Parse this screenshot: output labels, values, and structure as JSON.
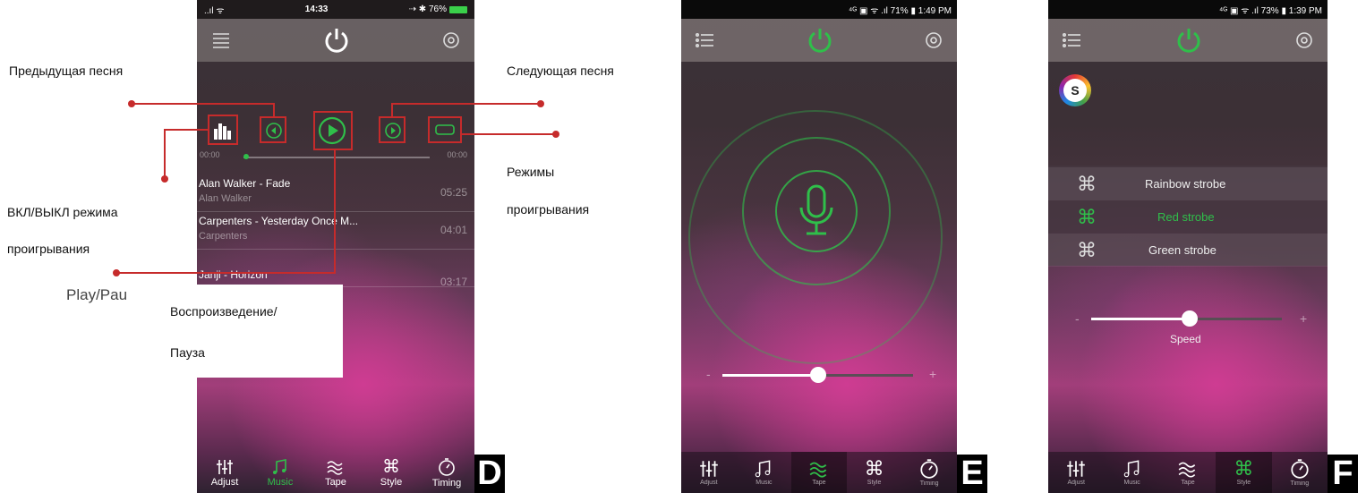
{
  "panels": {
    "d": {
      "status": {
        "signal": "..ıl ᯤ",
        "time": "14:33",
        "right": "⇢ ✱ 76%"
      },
      "song_times": {
        "start": "00:00",
        "end": "00:00"
      },
      "songs": [
        {
          "title": "Alan Walker - Fade",
          "artist": "Alan Walker",
          "duration": "05:25"
        },
        {
          "title": "Carpenters - Yesterday Once M...",
          "artist": "Carpenters",
          "duration": "04:01"
        },
        {
          "title": "Janji - Horizon",
          "artist": "",
          "duration": "03:17"
        }
      ],
      "tabs": [
        "Adjust",
        "Music",
        "Tape",
        "Style",
        "Timing"
      ],
      "active_tab": "Music",
      "letter": "D"
    },
    "e": {
      "status": "⁴ᴳ ▣ ᯤ .ıl 71% ▮ 1:49 PM",
      "tabs": [
        "Adjust",
        "Music",
        "Tape",
        "Style",
        "Timing"
      ],
      "active_tab": "Tape",
      "slider_minus": "-",
      "slider_plus": "+",
      "slider_value": 0.46,
      "letter": "E"
    },
    "f": {
      "status": "⁴ᴳ ▣ ᯤ .ıl 73% ▮ 1:39 PM",
      "logo_letter": "S",
      "strobes": [
        "Rainbow strobe",
        "Red strobe",
        "Green strobe"
      ],
      "selected_strobe": "Red strobe",
      "slider_minus": "-",
      "slider_plus": "+",
      "slider_label": "Speed",
      "slider_value": 0.51,
      "tabs": [
        "Adjust",
        "Music",
        "Tape",
        "Style",
        "Timing"
      ],
      "active_tab": "Style",
      "letter": "F"
    }
  },
  "annotations": {
    "prev_song": "Предыдущая  песня",
    "next_song": "Следующая песня",
    "modes_line1": "Режимы",
    "modes_line2": "проигрывания",
    "onoff_line1": "ВКЛ/ВЫКЛ режима",
    "onoff_line2": "проигрывания",
    "play_en": "Play/Pau",
    "play_ru_line1": "Воспроизведение/",
    "play_ru_line2": "Пауза"
  },
  "colors": {
    "accent_green": "#2fbf4a",
    "annotation_red": "#c62b2b"
  }
}
